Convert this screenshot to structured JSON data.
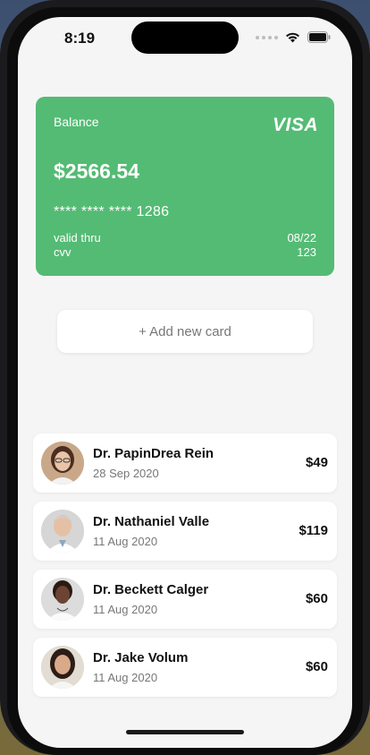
{
  "status_bar": {
    "time": "8:19"
  },
  "card": {
    "balance_label": "Balance",
    "brand": "VISA",
    "amount": "$2566.54",
    "number": "**** **** **** 1286",
    "valid_label": "valid thru",
    "valid_value": "08/22",
    "cvv_label": "cvv",
    "cvv_value": "123",
    "color": "#54bb74"
  },
  "add_card": {
    "label": "+ Add new card"
  },
  "transactions": [
    {
      "name": "Dr. PapinDrea Rein",
      "date": "28 Sep 2020",
      "price": "$49"
    },
    {
      "name": "Dr. Nathaniel Valle",
      "date": "11 Aug 2020",
      "price": "$119"
    },
    {
      "name": "Dr. Beckett Calger",
      "date": "11 Aug 2020",
      "price": "$60"
    },
    {
      "name": "Dr. Jake Volum",
      "date": "11 Aug 2020",
      "price": "$60"
    }
  ]
}
